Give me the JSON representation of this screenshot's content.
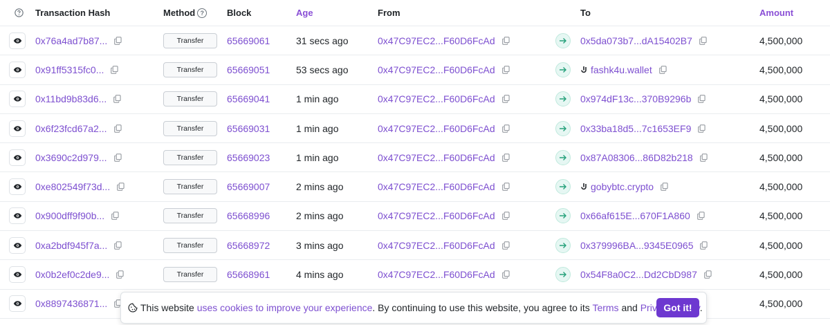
{
  "header": {
    "hash": "Transaction Hash",
    "method": "Method",
    "block": "Block",
    "age": "Age",
    "from": "From",
    "to": "To",
    "amount": "Amount"
  },
  "rows": [
    {
      "hash": "0x76a4ad7b87...",
      "method": "Transfer",
      "block": "65669061",
      "age": "31 secs ago",
      "from": "0x47C97EC2...F60D6FcAd",
      "to": "0x5da073b7...dA15402B7",
      "to_is_name": false,
      "amount": "4,500,000"
    },
    {
      "hash": "0x91ff5315fc0...",
      "method": "Transfer",
      "block": "65669051",
      "age": "53 secs ago",
      "from": "0x47C97EC2...F60D6FcAd",
      "to": "fashk4u.wallet",
      "to_is_name": true,
      "amount": "4,500,000"
    },
    {
      "hash": "0x11bd9b83d6...",
      "method": "Transfer",
      "block": "65669041",
      "age": "1 min ago",
      "from": "0x47C97EC2...F60D6FcAd",
      "to": "0x974dF13c...370B9296b",
      "to_is_name": false,
      "amount": "4,500,000"
    },
    {
      "hash": "0x6f23fcd67a2...",
      "method": "Transfer",
      "block": "65669031",
      "age": "1 min ago",
      "from": "0x47C97EC2...F60D6FcAd",
      "to": "0x33ba18d5...7c1653EF9",
      "to_is_name": false,
      "amount": "4,500,000"
    },
    {
      "hash": "0x3690c2d979...",
      "method": "Transfer",
      "block": "65669023",
      "age": "1 min ago",
      "from": "0x47C97EC2...F60D6FcAd",
      "to": "0x87A08306...86D82b218",
      "to_is_name": false,
      "amount": "4,500,000"
    },
    {
      "hash": "0xe802549f73d...",
      "method": "Transfer",
      "block": "65669007",
      "age": "2 mins ago",
      "from": "0x47C97EC2...F60D6FcAd",
      "to": "gobybtc.crypto",
      "to_is_name": true,
      "amount": "4,500,000"
    },
    {
      "hash": "0x900dff9f90b...",
      "method": "Transfer",
      "block": "65668996",
      "age": "2 mins ago",
      "from": "0x47C97EC2...F60D6FcAd",
      "to": "0x66af615E...670F1A860",
      "to_is_name": false,
      "amount": "4,500,000"
    },
    {
      "hash": "0xa2bdf945f7a...",
      "method": "Transfer",
      "block": "65668972",
      "age": "3 mins ago",
      "from": "0x47C97EC2...F60D6FcAd",
      "to": "0x379996BA...9345E0965",
      "to_is_name": false,
      "amount": "4,500,000"
    },
    {
      "hash": "0x0b2ef0c2de9...",
      "method": "Transfer",
      "block": "65668961",
      "age": "4 mins ago",
      "from": "0x47C97EC2...F60D6FcAd",
      "to": "0x54F8a0C2...Dd2CbD987",
      "to_is_name": false,
      "amount": "4,500,000"
    },
    {
      "hash": "0x8897436871...",
      "method": "",
      "block": "",
      "age": "",
      "from": "",
      "to": "",
      "to_is_name": false,
      "amount": "4,500,000"
    }
  ],
  "cookie": {
    "text_1": "This website ",
    "link_1": "uses cookies to improve your experience",
    "text_2": ". By continuing to use this website, you agree to its ",
    "link_2": "Terms",
    "text_3": " and ",
    "link_3": "Privacy Policy",
    "text_4": ".",
    "button": "Got it!"
  },
  "icons": {
    "eye": "eye-icon",
    "copy": "copy-icon",
    "arrow": "arrow-right-icon",
    "help": "question-circle-icon",
    "name_service": "name-service-icon",
    "cookie": "cookie-icon"
  },
  "colors": {
    "link": "#7d4fd0",
    "accent_button": "#6d38d0",
    "arrow_bg": "#e6f7f3",
    "arrow": "#26a17b"
  }
}
